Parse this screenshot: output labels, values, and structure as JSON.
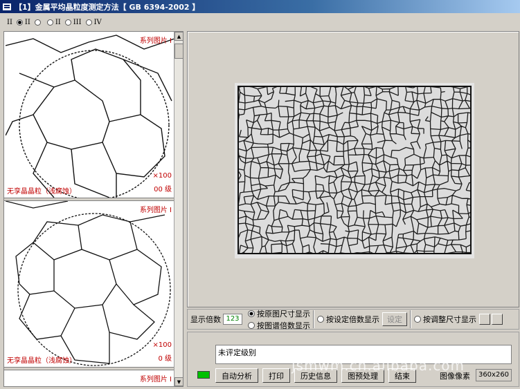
{
  "window": {
    "title": "【1】金属平均晶粒度测定方法【 GB 6394-2002 】"
  },
  "standard_series": {
    "options": [
      {
        "label": "II",
        "checked": false
      },
      {
        "label": "II",
        "checked": true
      },
      {
        "label": "",
        "checked": false
      },
      {
        "label": "II",
        "checked": false
      },
      {
        "label": "III",
        "checked": false
      },
      {
        "label": "IV",
        "checked": false
      }
    ]
  },
  "gallery": {
    "panels": [
      {
        "title": "系列图片 I",
        "magnification": "×100",
        "grade": "00 级",
        "caption": "无孪晶晶粒（浅腐蚀）"
      },
      {
        "title": "系列图片 I",
        "magnification": "×100",
        "grade": "0 级",
        "caption": "无孪晶晶粒（浅腐蚀）"
      },
      {
        "title": "系列图片 I"
      }
    ]
  },
  "display": {
    "zoom_label": "显示倍数",
    "zoom_value": "123",
    "option_original": "按原图尺寸显示",
    "option_chart": "按图谱倍数显示",
    "option_custom": "按设定倍数显示",
    "set_button": "设定",
    "option_adjust": "按调整尺寸显示"
  },
  "result": {
    "text": "未评定级别",
    "status_color": "#00c000"
  },
  "actions": {
    "auto_analyze": "自动分析",
    "print": "打印",
    "history": "历史信息",
    "preprocess": "图预处理",
    "finish": "结束"
  },
  "image_info": {
    "pixels_label": "图像像素",
    "pixels_value": "360x260"
  },
  "watermark": "jsmwm.cn.alibaba.com"
}
